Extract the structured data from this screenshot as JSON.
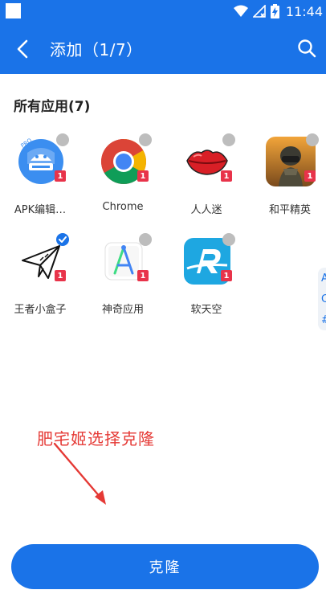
{
  "status_bar": {
    "time": "11:44"
  },
  "header": {
    "title": "添加（1/7）"
  },
  "section": {
    "title": "所有应用(7)"
  },
  "apps": [
    {
      "label": "APK编辑…",
      "badge": "1",
      "selected": false,
      "icon": "apk-editor-icon"
    },
    {
      "label": "Chrome",
      "badge": "1",
      "selected": false,
      "icon": "chrome-icon"
    },
    {
      "label": "人人迷",
      "badge": "1",
      "selected": false,
      "icon": "lips-icon"
    },
    {
      "label": "和平精英",
      "badge": "1",
      "selected": false,
      "icon": "game-soldier-icon"
    },
    {
      "label": "王者小盒子",
      "badge": "1",
      "selected": true,
      "icon": "paper-plane-icon"
    },
    {
      "label": "神奇应用",
      "badge": "1",
      "selected": false,
      "icon": "android-studio-icon"
    },
    {
      "label": "软天空",
      "badge": "1",
      "selected": false,
      "icon": "ruantiankong-icon"
    }
  ],
  "peek": {
    "lines": [
      "A",
      "C",
      "#"
    ]
  },
  "annotation": {
    "text": "肥宅姬选择克隆"
  },
  "actions": {
    "clone_label": "克隆"
  },
  "colors": {
    "primary": "#1a73e8",
    "badge": "#e8334a",
    "annotation": "#e53935"
  }
}
